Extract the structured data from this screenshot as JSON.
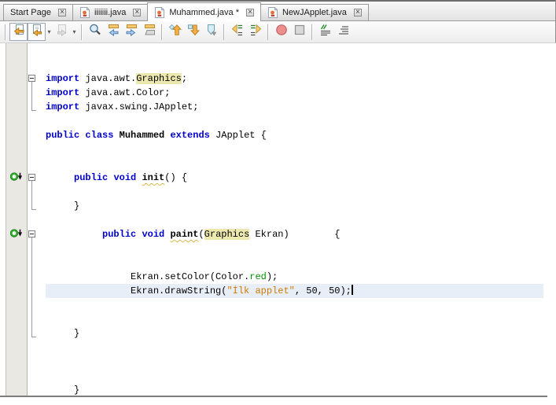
{
  "tab_bar": {
    "tabs": [
      {
        "label": "Start Page",
        "icon": null,
        "active": false
      },
      {
        "label": "iiiiiii.java",
        "icon": "java-file-icon",
        "active": false
      },
      {
        "label": "Muhammed.java *",
        "icon": "java-file-icon",
        "active": true
      },
      {
        "label": "NewJApplet.java",
        "icon": "java-file-icon",
        "active": false
      }
    ]
  },
  "toolbar": {
    "groups": [
      [
        {
          "name": "last-edit-location",
          "icon": "last-edit-icon",
          "framed": true
        },
        {
          "name": "back",
          "icon": "back-icon",
          "framed": true,
          "dropdown": true
        },
        {
          "name": "forward",
          "icon": "forward-icon",
          "disabled": true,
          "dropdown": true
        }
      ],
      [
        {
          "name": "find-selection",
          "icon": "find-selection-icon"
        },
        {
          "name": "find-previous-occurrence",
          "icon": "find-previous-icon"
        },
        {
          "name": "find-next-occurrence",
          "icon": "find-next-icon"
        },
        {
          "name": "toggle-highlight-search",
          "icon": "toggle-highlight-icon"
        }
      ],
      [
        {
          "name": "previous-bookmark",
          "icon": "previous-bookmark-icon"
        },
        {
          "name": "next-bookmark",
          "icon": "next-bookmark-icon"
        },
        {
          "name": "toggle-bookmark",
          "icon": "toggle-bookmark-icon"
        }
      ],
      [
        {
          "name": "shift-line-left",
          "icon": "shift-left-icon"
        },
        {
          "name": "shift-line-right",
          "icon": "shift-right-icon"
        }
      ],
      [
        {
          "name": "start-macro-recording",
          "icon": "record-icon"
        },
        {
          "name": "stop-macro-recording",
          "icon": "stop-icon"
        }
      ],
      [
        {
          "name": "comment",
          "icon": "comment-icon"
        },
        {
          "name": "uncomment",
          "icon": "uncomment-icon"
        }
      ]
    ]
  },
  "editor": {
    "colors": {
      "keyword": "#0000cc",
      "string": "#ce7b00",
      "field": "#009300",
      "occurrence_bg": "#ede9ae",
      "current_line_bg": "#e8eef7",
      "gutter_bg": "#e9e8e2"
    },
    "lines": [
      {},
      {},
      {
        "fold": "start",
        "seg": [
          [
            "kw",
            "import"
          ],
          [
            "pl",
            " java.awt."
          ],
          [
            "occ",
            "Graphics"
          ],
          [
            "pl",
            ";"
          ]
        ]
      },
      {
        "fold": "line",
        "seg": [
          [
            "kw",
            "import"
          ],
          [
            "pl",
            " java.awt.Color;"
          ]
        ]
      },
      {
        "fold": "end",
        "seg": [
          [
            "kw",
            "import"
          ],
          [
            "pl",
            " javax.swing.JApplet;"
          ]
        ]
      },
      {},
      {
        "seg": [
          [
            "kw",
            "public"
          ],
          [
            "pl",
            " "
          ],
          [
            "kw",
            "class"
          ],
          [
            "pl",
            " "
          ],
          [
            "type",
            "Muhammed"
          ],
          [
            "pl",
            " "
          ],
          [
            "kw",
            "extends"
          ],
          [
            "pl",
            " JApplet {"
          ]
        ]
      },
      {},
      {},
      {
        "gutter": true,
        "fold": "start",
        "seg": [
          [
            "pl",
            "     "
          ],
          [
            "kw",
            "public"
          ],
          [
            "pl",
            " "
          ],
          [
            "kw",
            "void"
          ],
          [
            "pl",
            " "
          ],
          [
            "mth",
            "init"
          ],
          [
            "pl",
            "() {"
          ]
        ]
      },
      {
        "fold": "line"
      },
      {
        "fold": "end",
        "seg": [
          [
            "pl",
            "     }"
          ]
        ]
      },
      {},
      {
        "gutter": true,
        "fold": "start",
        "seg": [
          [
            "pl",
            "          "
          ],
          [
            "kw",
            "public"
          ],
          [
            "pl",
            " "
          ],
          [
            "kw",
            "void"
          ],
          [
            "pl",
            " "
          ],
          [
            "mth",
            "paint"
          ],
          [
            "pl",
            "("
          ],
          [
            "occ",
            "Graphics"
          ],
          [
            "pl",
            " Ekran)        {"
          ]
        ]
      },
      {
        "fold": "line"
      },
      {
        "fold": "line"
      },
      {
        "fold": "line",
        "seg": [
          [
            "pl",
            "               Ekran.setColor(Color."
          ],
          [
            "fld",
            "red"
          ],
          [
            "pl",
            ");"
          ]
        ]
      },
      {
        "fold": "line",
        "current": true,
        "caret": true,
        "seg": [
          [
            "pl",
            "               Ekran.drawString("
          ],
          [
            "str",
            "\"İlk applet\""
          ],
          [
            "pl",
            ", 50, 50);"
          ]
        ]
      },
      {
        "fold": "line"
      },
      {
        "fold": "line"
      },
      {
        "fold": "end",
        "seg": [
          [
            "pl",
            "     }"
          ]
        ]
      },
      {},
      {},
      {},
      {
        "seg": [
          [
            "pl",
            "     }"
          ]
        ]
      }
    ]
  }
}
